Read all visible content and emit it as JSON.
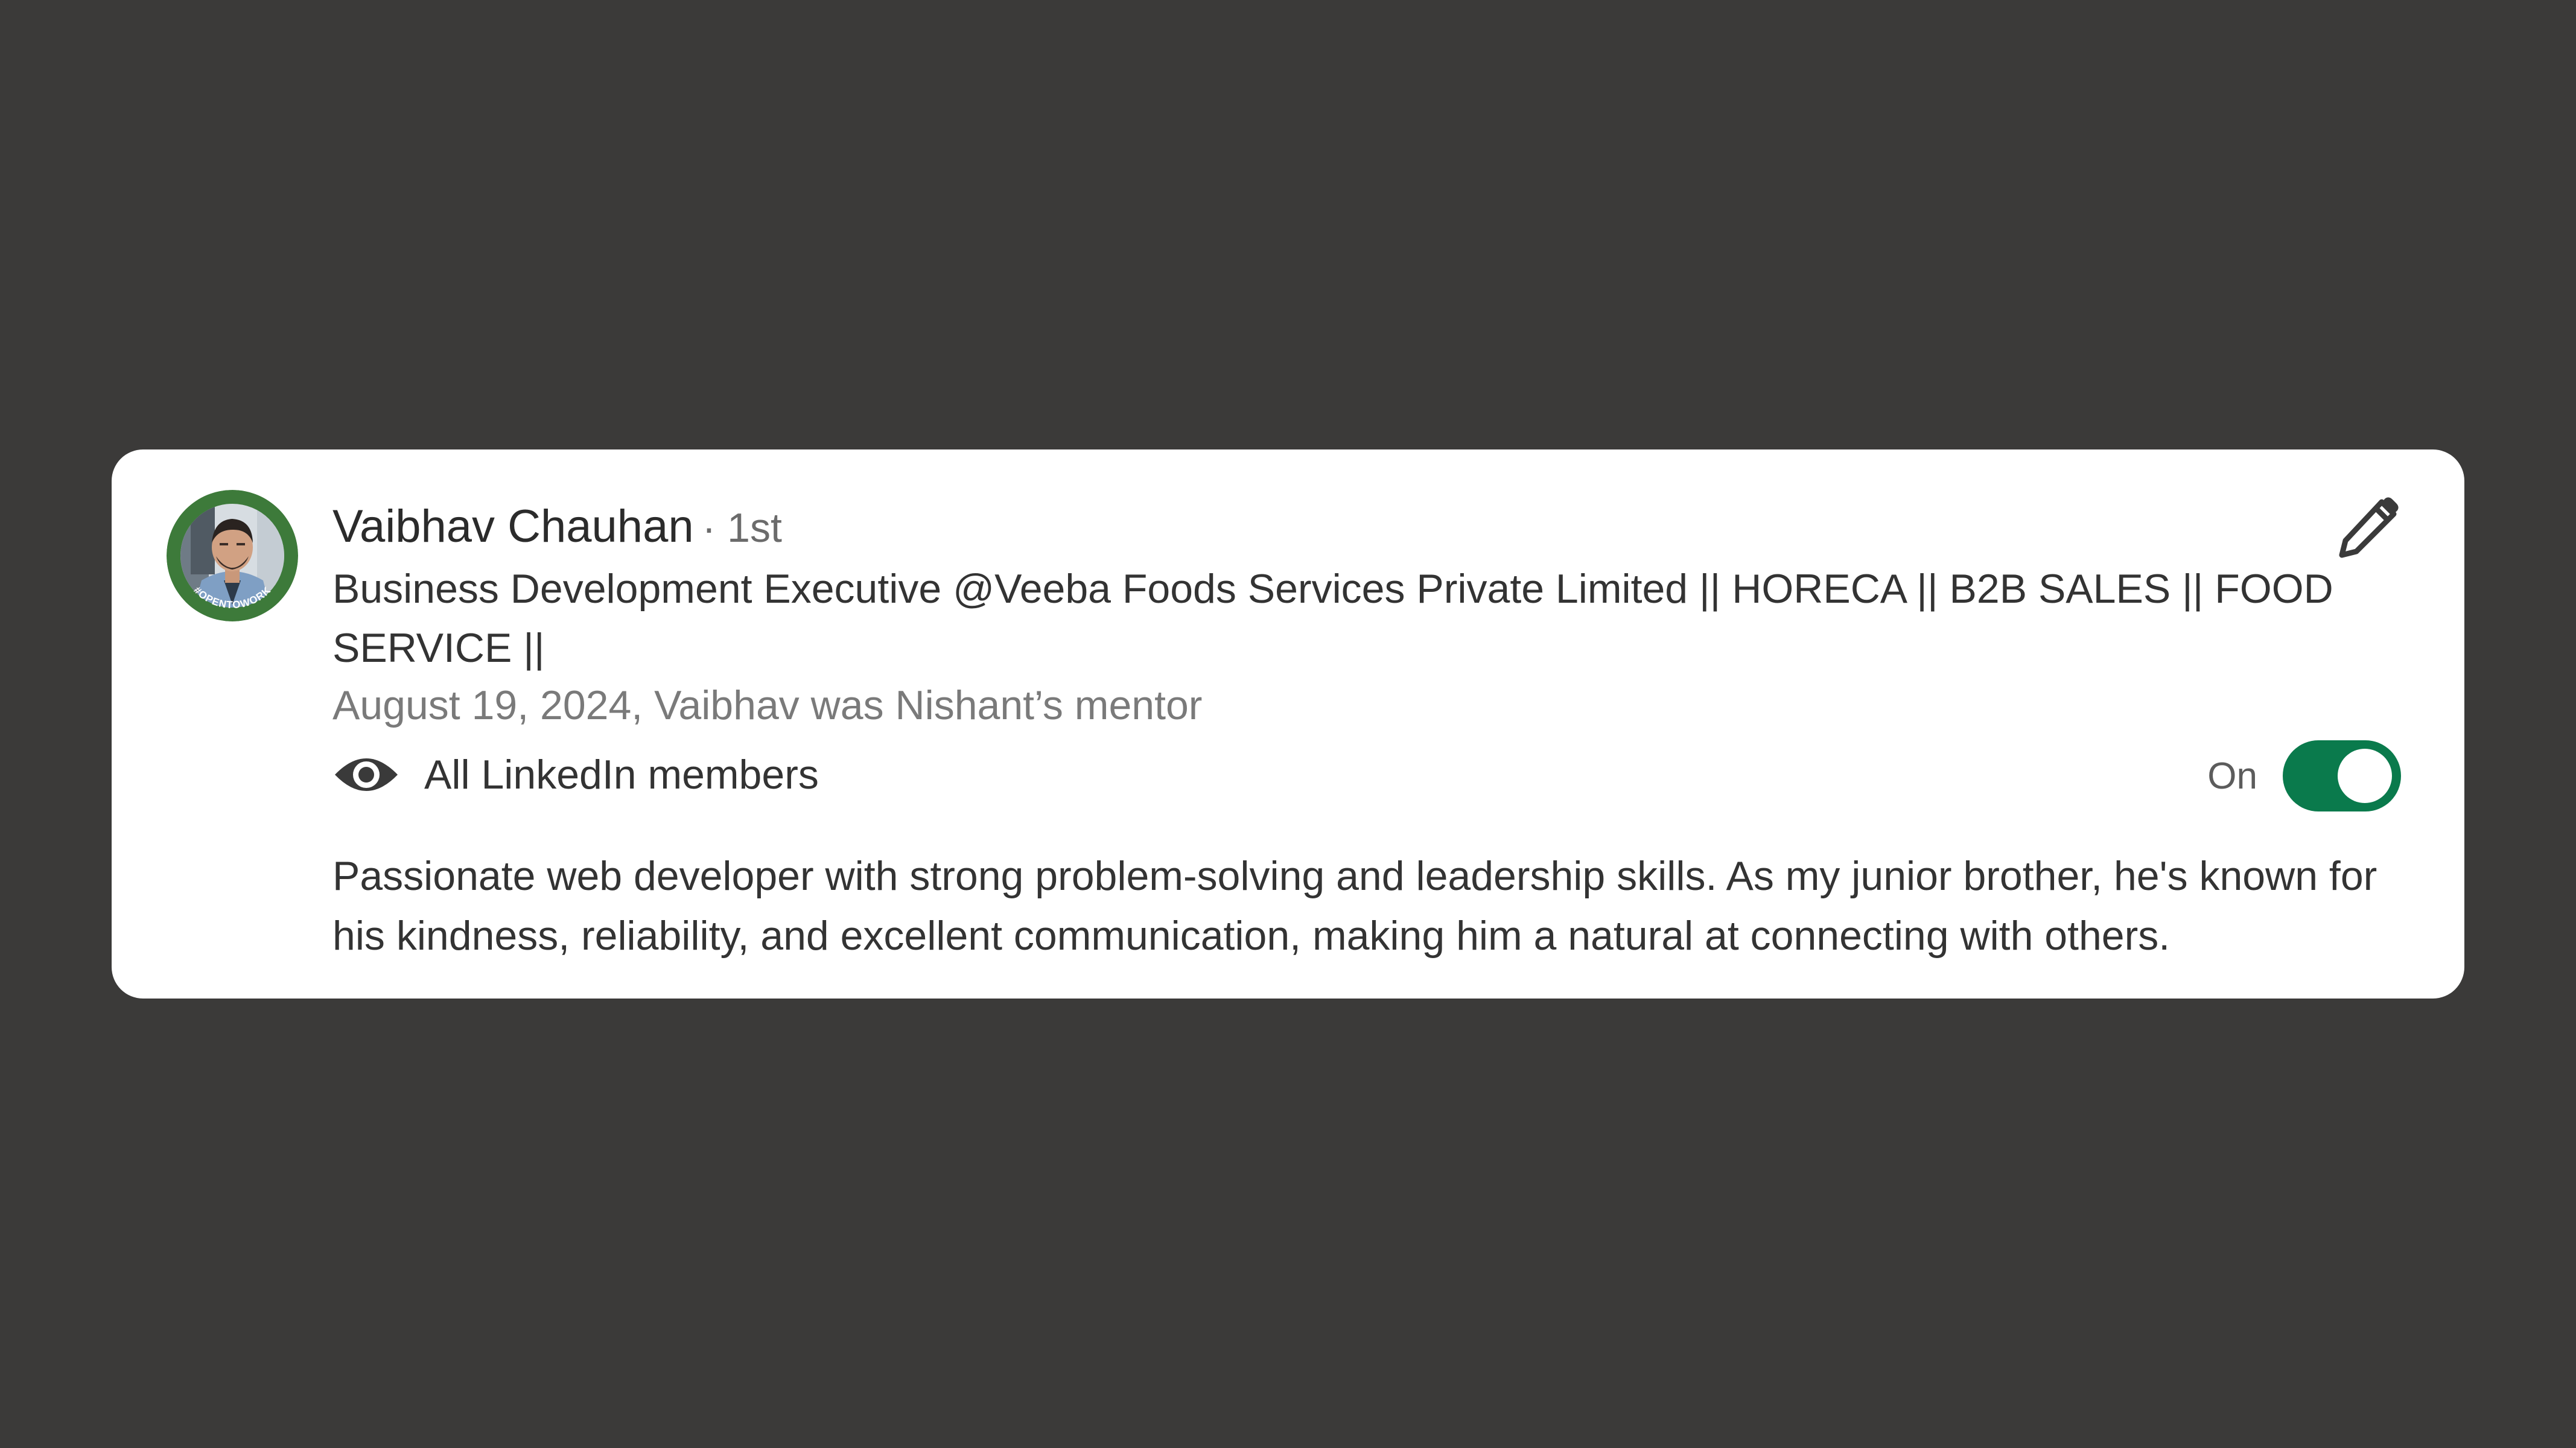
{
  "recommendation_card": {
    "author": {
      "name": "Vaibhav Chauhan",
      "connection_degree": "· 1st",
      "headline": "Business Development Executive @Veeba Foods Services Private Limited || HORECA || B2B SALES || FOOD SERVICE ||",
      "avatar_badge_text": "#OPENTOWORK"
    },
    "date_relationship": "August 19, 2024, Vaibhav was Nishant’s mentor",
    "visibility": {
      "icon": "eye-icon",
      "label": "All LinkedIn members"
    },
    "toggle": {
      "status_label": "On",
      "state": true,
      "color": "#0a7a4c"
    },
    "edit_icon": "pencil-icon",
    "text": "Passionate web developer with strong problem-solving and leadership skills. As my junior brother, he's known for his kindness, reliability, and excellent communication, making him a natural at connecting with others."
  },
  "colors": {
    "background": "#3b3a39",
    "card": "#ffffff",
    "open_to_work_ring": "#3d7a3a"
  }
}
